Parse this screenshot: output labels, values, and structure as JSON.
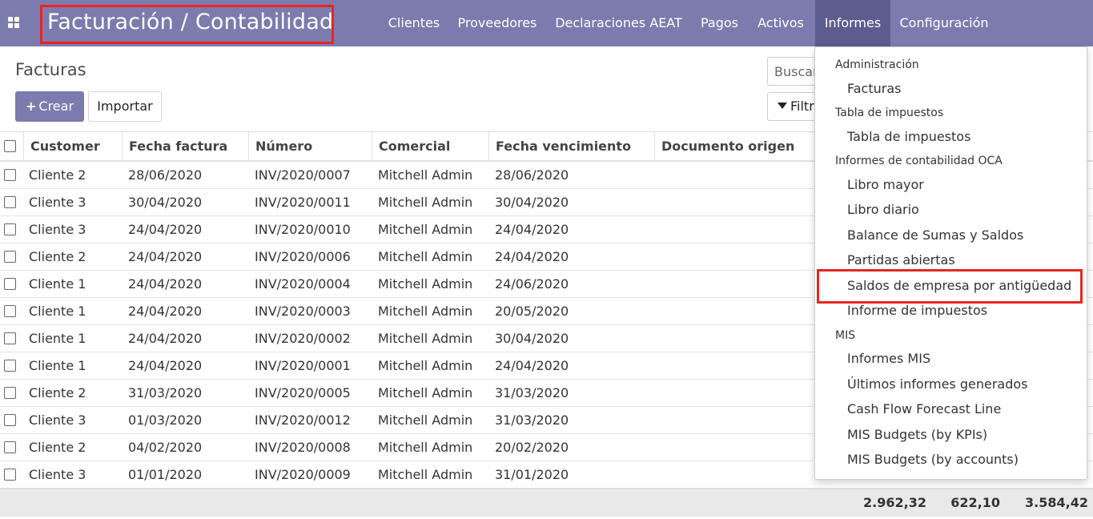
{
  "navbar": {
    "brand": "Facturación / Contabilidad",
    "menu": [
      "Clientes",
      "Proveedores",
      "Declaraciones AEAT",
      "Pagos",
      "Activos",
      "Informes",
      "Configuración"
    ]
  },
  "control_panel": {
    "title": "Facturas",
    "create_label": "Crear",
    "import_label": "Importar",
    "search_placeholder": "Buscar",
    "filter_label": "Filtros"
  },
  "table": {
    "headers": [
      "Customer",
      "Fecha factura",
      "Número",
      "Comercial",
      "Fecha vencimiento",
      "Documento origen"
    ],
    "rows": [
      [
        "Cliente 2",
        "28/06/2020",
        "INV/2020/0007",
        "Mitchell Admin",
        "28/06/2020"
      ],
      [
        "Cliente 3",
        "30/04/2020",
        "INV/2020/0011",
        "Mitchell Admin",
        "30/04/2020"
      ],
      [
        "Cliente 3",
        "24/04/2020",
        "INV/2020/0010",
        "Mitchell Admin",
        "24/04/2020"
      ],
      [
        "Cliente 2",
        "24/04/2020",
        "INV/2020/0006",
        "Mitchell Admin",
        "24/04/2020"
      ],
      [
        "Cliente 1",
        "24/04/2020",
        "INV/2020/0004",
        "Mitchell Admin",
        "24/06/2020"
      ],
      [
        "Cliente 1",
        "24/04/2020",
        "INV/2020/0003",
        "Mitchell Admin",
        "20/05/2020"
      ],
      [
        "Cliente 1",
        "24/04/2020",
        "INV/2020/0002",
        "Mitchell Admin",
        "30/04/2020"
      ],
      [
        "Cliente 1",
        "24/04/2020",
        "INV/2020/0001",
        "Mitchell Admin",
        "24/04/2020"
      ],
      [
        "Cliente 2",
        "31/03/2020",
        "INV/2020/0005",
        "Mitchell Admin",
        "31/03/2020"
      ],
      [
        "Cliente 3",
        "01/03/2020",
        "INV/2020/0012",
        "Mitchell Admin",
        "31/03/2020"
      ],
      [
        "Cliente 2",
        "04/02/2020",
        "INV/2020/0008",
        "Mitchell Admin",
        "20/02/2020"
      ],
      [
        "Cliente 3",
        "01/01/2020",
        "INV/2020/0009",
        "Mitchell Admin",
        "31/01/2020"
      ]
    ],
    "totals": [
      "2.962,32",
      "622,10",
      "3.584,42"
    ]
  },
  "dropdown": {
    "sections": [
      {
        "header": "Administración",
        "items": [
          "Facturas"
        ]
      },
      {
        "header": "Tabla de impuestos",
        "items": [
          "Tabla de impuestos"
        ]
      },
      {
        "header": "Informes de contabilidad OCA",
        "items": [
          "Libro mayor",
          "Libro diario",
          "Balance de Sumas y Saldos",
          "Partidas abiertas",
          "Saldos de empresa por antigüedad",
          "Informe de impuestos"
        ]
      },
      {
        "header": "MIS",
        "items": [
          "Informes MIS",
          "Últimos informes generados",
          "Cash Flow Forecast Line",
          "MIS Budgets (by KPIs)",
          "MIS Budgets (by accounts)"
        ]
      }
    ],
    "highlighted_item": "Saldos de empresa por antigüedad"
  },
  "colors": {
    "navbar": "#7c7bad",
    "navbar_active": "#5d5c8f",
    "highlight": "#e8251f",
    "footer": "#e9e9e9"
  }
}
